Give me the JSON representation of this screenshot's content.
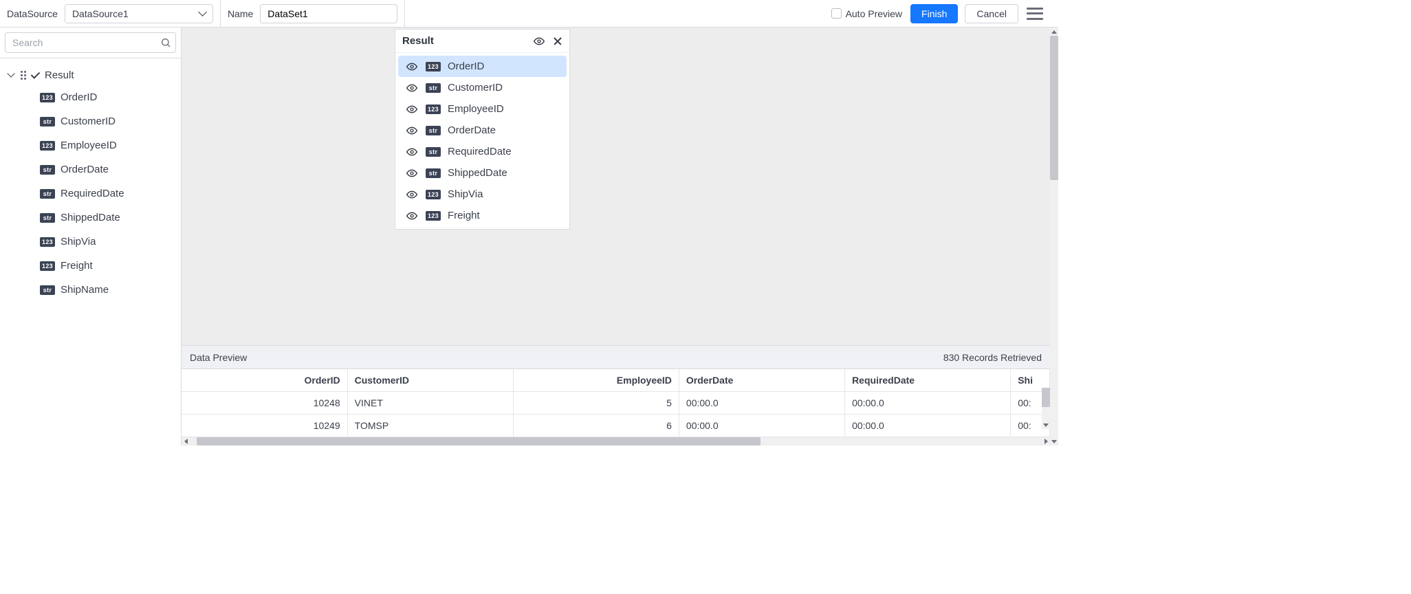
{
  "topbar": {
    "datasource_label": "DataSource",
    "datasource_value": "DataSource1",
    "name_label": "Name",
    "name_value": "DataSet1",
    "auto_preview_label": "Auto Preview",
    "finish_label": "Finish",
    "cancel_label": "Cancel"
  },
  "search": {
    "placeholder": "Search"
  },
  "tree": {
    "root": "Result",
    "fields": [
      {
        "type": "123",
        "name": "OrderID"
      },
      {
        "type": "str",
        "name": "CustomerID"
      },
      {
        "type": "123",
        "name": "EmployeeID"
      },
      {
        "type": "str",
        "name": "OrderDate"
      },
      {
        "type": "str",
        "name": "RequiredDate"
      },
      {
        "type": "str",
        "name": "ShippedDate"
      },
      {
        "type": "123",
        "name": "ShipVia"
      },
      {
        "type": "123",
        "name": "Freight"
      },
      {
        "type": "str",
        "name": "ShipName"
      }
    ]
  },
  "result_panel": {
    "title": "Result",
    "fields": [
      {
        "type": "123",
        "name": "OrderID",
        "selected": true
      },
      {
        "type": "str",
        "name": "CustomerID"
      },
      {
        "type": "123",
        "name": "EmployeeID"
      },
      {
        "type": "str",
        "name": "OrderDate"
      },
      {
        "type": "str",
        "name": "RequiredDate"
      },
      {
        "type": "str",
        "name": "ShippedDate"
      },
      {
        "type": "123",
        "name": "ShipVia"
      },
      {
        "type": "123",
        "name": "Freight"
      }
    ]
  },
  "preview": {
    "title": "Data Preview",
    "records_label": "830 Records Retrieved",
    "columns": [
      "OrderID",
      "CustomerID",
      "EmployeeID",
      "OrderDate",
      "RequiredDate",
      "Shi"
    ],
    "rows": [
      {
        "OrderID": "10248",
        "CustomerID": "VINET",
        "EmployeeID": "5",
        "OrderDate": "00:00.0",
        "RequiredDate": "00:00.0",
        "Shi": "00:"
      },
      {
        "OrderID": "10249",
        "CustomerID": "TOMSP",
        "EmployeeID": "6",
        "OrderDate": "00:00.0",
        "RequiredDate": "00:00.0",
        "Shi": "00:"
      }
    ]
  }
}
